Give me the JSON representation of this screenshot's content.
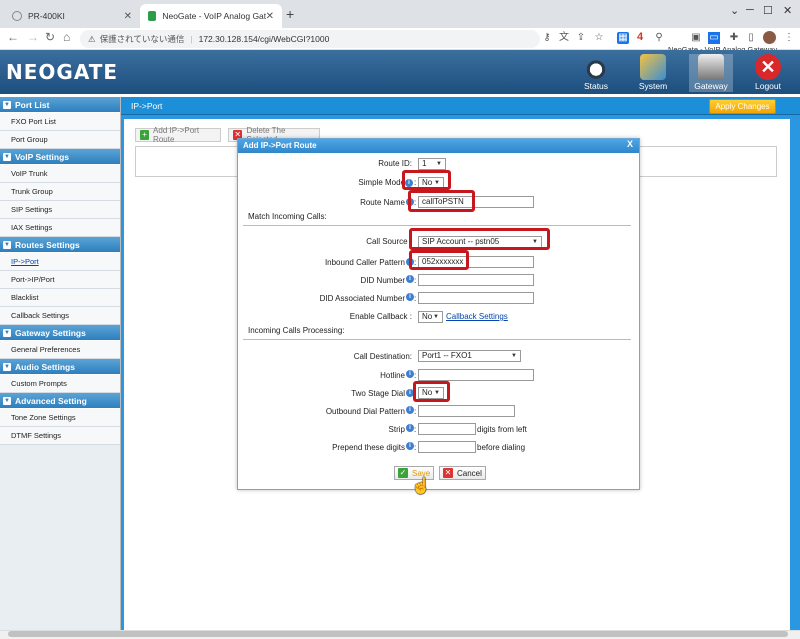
{
  "browser": {
    "tabs": [
      {
        "title": "PR-400KI",
        "active": false
      },
      {
        "title": "NeoGate - VoIP Analog Gateway",
        "active": true
      }
    ],
    "security_label": "保護されていない通信",
    "url": "172.30.128.154/cgi/WebCGI?1000",
    "tooltip": "NeoGate - VoIP Analog Gateway",
    "extension_badge": "4"
  },
  "app": {
    "logo": "NEOGATE",
    "nav": [
      {
        "label": "Status",
        "icon": "status-icon"
      },
      {
        "label": "System",
        "icon": "system-icon"
      },
      {
        "label": "Gateway",
        "icon": "gateway-icon"
      },
      {
        "label": "Logout",
        "icon": "logout-icon"
      }
    ],
    "breadcrumb": "IP->Port",
    "apply_label": "Apply Changes",
    "add_label": "Add IP->Port Route",
    "delete_label": "Delete The Selected"
  },
  "sidebar": [
    {
      "header": "Port List",
      "items": [
        "FXO Port List",
        "Port Group"
      ]
    },
    {
      "header": "VoIP Settings",
      "items": [
        "VoIP Trunk",
        "Trunk Group",
        "SIP Settings",
        "IAX Settings"
      ]
    },
    {
      "header": "Routes Settings",
      "items": [
        "IP->Port",
        "Port->IP/Port",
        "Blacklist",
        "Callback Settings"
      ]
    },
    {
      "header": "Gateway Settings",
      "items": [
        "General Preferences"
      ]
    },
    {
      "header": "Audio Settings",
      "items": [
        "Custom Prompts"
      ]
    },
    {
      "header": "Advanced Setting",
      "items": [
        "Tone Zone Settings",
        "DTMF Settings"
      ]
    }
  ],
  "dialog": {
    "title": "Add IP->Port Route",
    "close": "X",
    "route_id_label": "Route ID:",
    "route_id_value": "1",
    "simple_mode_label": "Simple Mode",
    "simple_mode_value": "No",
    "route_name_label": "Route Name",
    "route_name_value": "callToPSTN",
    "match_section": "Match Incoming Calls:",
    "call_source_label": "Call Source :",
    "call_source_value": "SIP Account -- pstn05",
    "inbound_pattern_label": "Inbound Caller Pattern",
    "inbound_pattern_value": "052xxxxxxx",
    "did_label": "DID Number",
    "did_assoc_label": "DID Associated Number",
    "enable_callback_label": "Enable Callback :",
    "enable_callback_value": "No",
    "callback_link": "Callback Settings",
    "processing_section": "Incoming Calls Processing:",
    "call_dest_label": "Call Destination:",
    "call_dest_value": "Port1 -- FXO1",
    "hotline_label": "Hotline",
    "two_stage_label": "Two Stage Dial",
    "two_stage_value": "No",
    "outbound_pattern_label": "Outbound Dial Pattern",
    "strip_label": "Strip",
    "strip_after": "digits from left",
    "prepend_label": "Prepend these digits",
    "prepend_after": "before dialing",
    "save_label": "Save",
    "cancel_label": "Cancel"
  },
  "colors": {
    "header": "#1c4e7e",
    "sidebar_header": "#2e7fbf",
    "apply": "#f3a500",
    "highlight": "#c8161d"
  }
}
